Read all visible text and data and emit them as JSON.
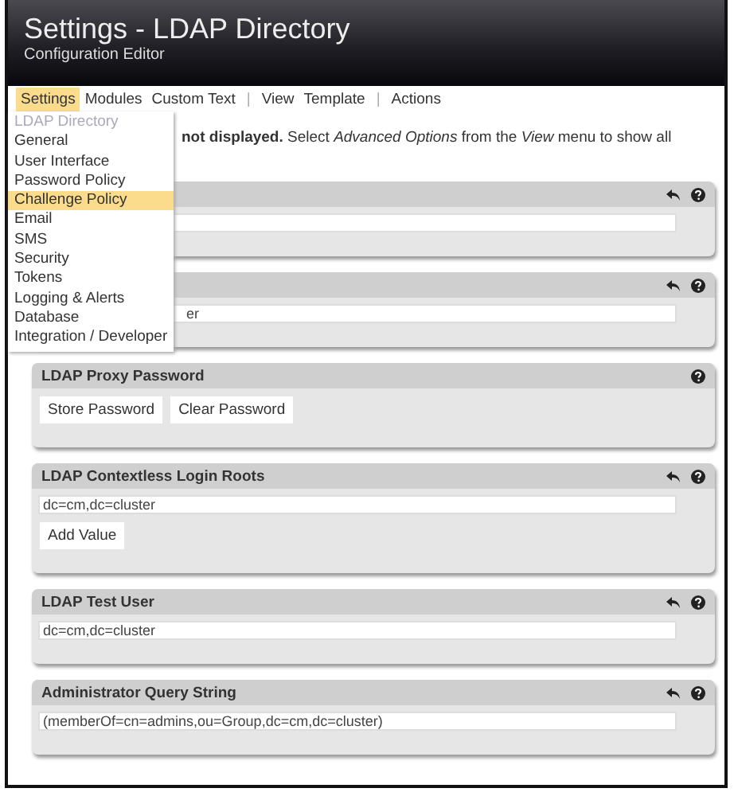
{
  "header": {
    "title": "Settings - LDAP Directory",
    "subtitle": "Configuration Editor"
  },
  "menu": [
    {
      "label": "Settings",
      "kind": "item",
      "selected": true
    },
    {
      "label": "Modules",
      "kind": "item",
      "selected": false
    },
    {
      "label": "Custom Text",
      "kind": "item",
      "selected": false
    },
    {
      "label": "|",
      "kind": "separator"
    },
    {
      "label": "View",
      "kind": "item",
      "selected": false
    },
    {
      "label": "Template",
      "kind": "item",
      "selected": false
    },
    {
      "label": "|",
      "kind": "separator"
    },
    {
      "label": "Actions",
      "kind": "item",
      "selected": false
    }
  ],
  "dropdown": [
    {
      "label": "LDAP Directory",
      "disabled": true,
      "selected": false
    },
    {
      "label": "General",
      "disabled": false,
      "selected": false
    },
    {
      "label": "User Interface",
      "disabled": false,
      "selected": false
    },
    {
      "label": "Password Policy",
      "disabled": false,
      "selected": false
    },
    {
      "label": "Challenge Policy",
      "disabled": false,
      "selected": true
    },
    {
      "label": "Email",
      "disabled": false,
      "selected": false
    },
    {
      "label": "SMS",
      "disabled": false,
      "selected": false
    },
    {
      "label": "Security",
      "disabled": false,
      "selected": false
    },
    {
      "label": "Tokens",
      "disabled": false,
      "selected": false
    },
    {
      "label": "Logging & Alerts",
      "disabled": false,
      "selected": false
    },
    {
      "label": "Database",
      "disabled": false,
      "selected": false
    },
    {
      "label": "Integration / Developer",
      "disabled": false,
      "selected": false
    }
  ],
  "notice": "**not displayed.**  Select *Advanced Options* from the *View* menu to show all",
  "panels": [
    {
      "kind": "text",
      "undo": true
    },
    {
      "kind": "text",
      "undo": true,
      "value": "er"
    },
    {
      "kind": "buttons",
      "title": "LDAP Proxy Password",
      "undo": false,
      "buttons": [
        "Store Password",
        "Clear Password"
      ]
    },
    {
      "kind": "list",
      "title": "LDAP Contextless Login Roots",
      "undo": true,
      "value": "dc=cm,dc=cluster",
      "button": "Add Value"
    },
    {
      "kind": "text",
      "title": "LDAP Test User",
      "undo": true,
      "value": "dc=cm,dc=cluster"
    },
    {
      "kind": "text",
      "title": "Administrator Query String",
      "undo": true,
      "value": "(memberOf=cn=admins,ou=Group,dc=cm,dc=cluster)"
    }
  ]
}
